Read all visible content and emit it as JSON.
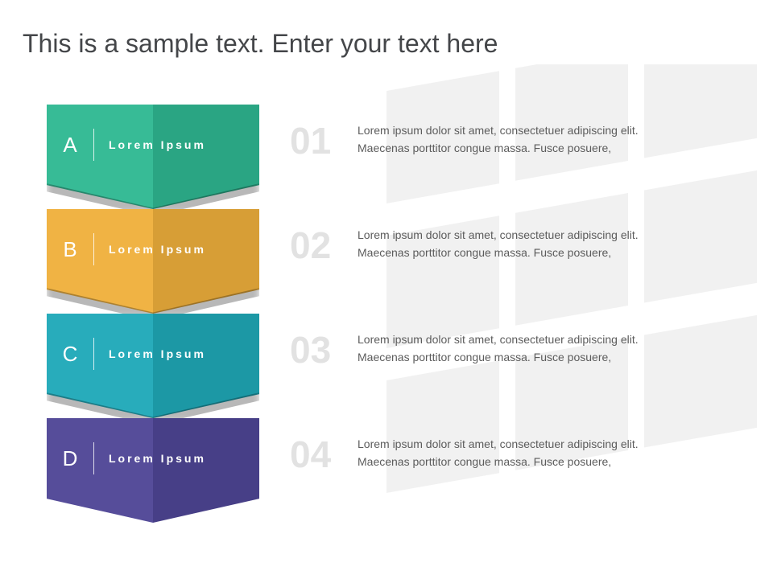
{
  "title": "This is a sample text. Enter your text here",
  "items": [
    {
      "letter": "A",
      "label": "Lorem Ipsum",
      "number": "01",
      "desc": "Lorem ipsum dolor sit amet, consectetuer adipiscing elit. Maecenas porttitor congue massa. Fusce posuere,",
      "color": "#2fb892"
    },
    {
      "letter": "B",
      "label": "Lorem Ipsum",
      "number": "02",
      "desc": "Lorem ipsum dolor sit amet, consectetuer adipiscing elit. Maecenas porttitor congue massa. Fusce posuere,",
      "color": "#efb03c"
    },
    {
      "letter": "C",
      "label": "Lorem Ipsum",
      "number": "03",
      "desc": "Lorem ipsum dolor sit amet, consectetuer adipiscing elit. Maecenas porttitor congue massa. Fusce posuere,",
      "color": "#1fa9b8"
    },
    {
      "letter": "D",
      "label": "Lorem Ipsum",
      "number": "04",
      "desc": "Lorem ipsum dolor sit amet, consectetuer adipiscing elit. Maecenas porttitor congue massa. Fusce posuere,",
      "color": "#4f4696"
    }
  ]
}
